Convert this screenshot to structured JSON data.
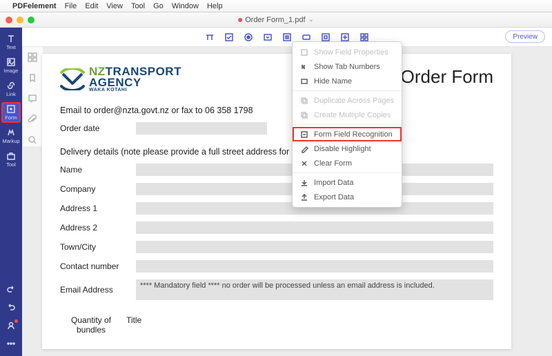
{
  "mac_menu": {
    "app": "PDFelement",
    "items": [
      "File",
      "Edit",
      "View",
      "Tool",
      "Go",
      "Window",
      "Help"
    ]
  },
  "window": {
    "doc_title": "Order Form_1.pdf"
  },
  "left_rail": {
    "items": [
      {
        "label": "Text"
      },
      {
        "label": "Image"
      },
      {
        "label": "Link"
      },
      {
        "label": "Form"
      },
      {
        "label": "Markup"
      },
      {
        "label": "Tool"
      }
    ],
    "selected_index": 3
  },
  "toolbar": {
    "preview_label": "Preview"
  },
  "ctx_menu": {
    "items": [
      {
        "label": "Show Field Properties",
        "disabled": true
      },
      {
        "label": "Show Tab Numbers",
        "disabled": false
      },
      {
        "label": "Hide Name",
        "disabled": false
      },
      {
        "sep": true
      },
      {
        "label": "Duplicate Across Pages",
        "disabled": true
      },
      {
        "label": "Create Multiple Copies",
        "disabled": true
      },
      {
        "sep": true
      },
      {
        "label": "Form Field Recognition",
        "disabled": false,
        "highlight": true
      },
      {
        "label": "Disable Highlight",
        "disabled": false
      },
      {
        "label": "Clear Form",
        "disabled": false
      },
      {
        "sep": true
      },
      {
        "label": "Import Data",
        "disabled": false
      },
      {
        "label": "Export Data",
        "disabled": false
      }
    ]
  },
  "page": {
    "logo": {
      "prefix": "NZ",
      "line1": "TRANSPORT",
      "line2": "AGENCY",
      "sub": "WAKA KOTAHI"
    },
    "title": "Order Form",
    "email_line": "Email to order@nzta.govt.nz or fax to 06 358 1798",
    "order_date_label": "Order date",
    "delivery_header": "Delivery details (note please provide a full street address for courier delivery)",
    "fields": [
      {
        "label": "Name"
      },
      {
        "label": "Company"
      },
      {
        "label": "Address 1"
      },
      {
        "label": "Address 2"
      },
      {
        "label": "Town/City"
      },
      {
        "label": "Contact number"
      }
    ],
    "email_field_label": "Email Address",
    "email_field_note": "**** Mandatory field **** no order will be processed unless an email address is included.",
    "table": {
      "col1": "Quantity of bundles",
      "col2": "Title"
    }
  }
}
